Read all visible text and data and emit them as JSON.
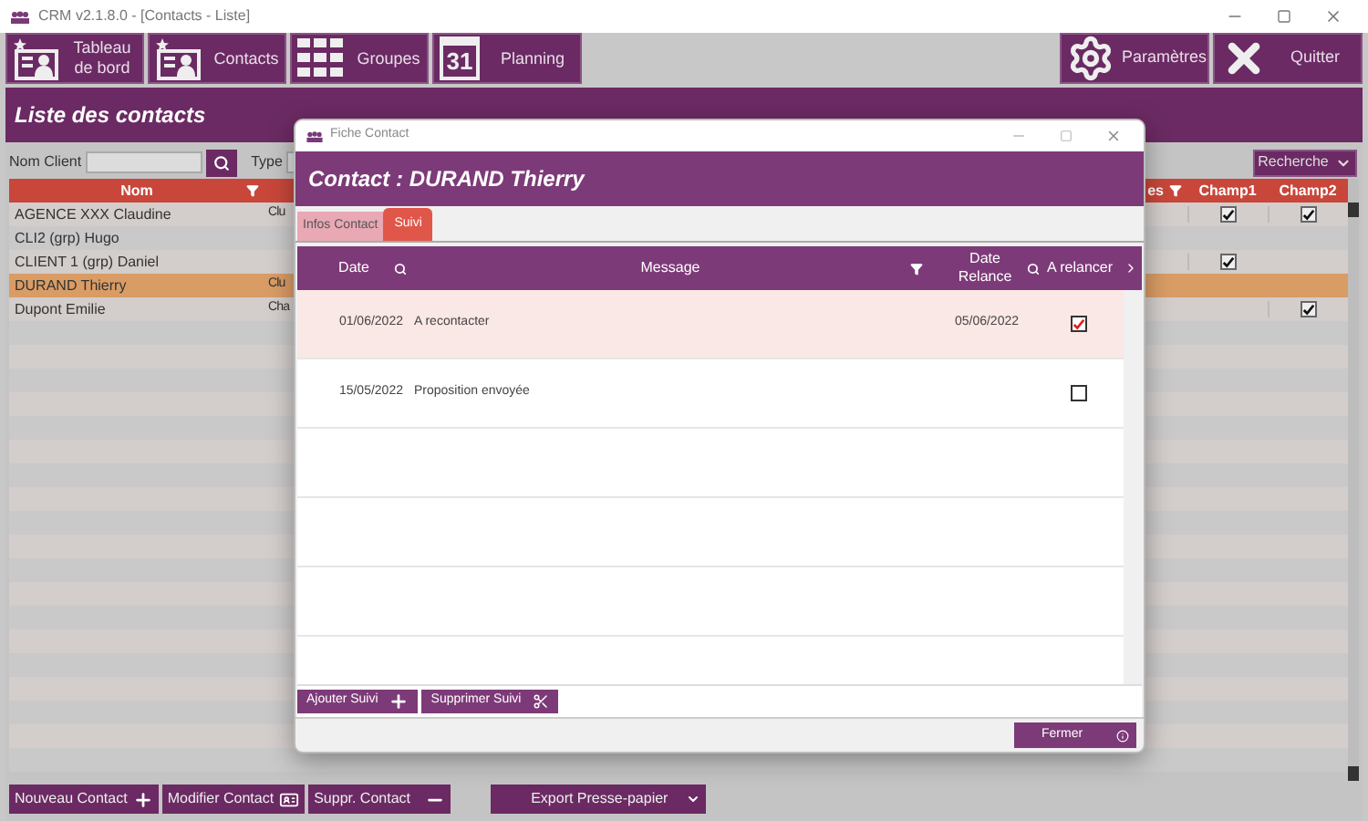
{
  "window": {
    "title": "CRM v2.1.8.0 - [Contacts - Liste]"
  },
  "toolbar": {
    "left": [
      {
        "kind": "contact",
        "label": "Tableau de bord"
      },
      {
        "kind": "contact",
        "label": "Contacts"
      },
      {
        "kind": "grid",
        "label": "Groupes"
      },
      {
        "kind": "calendar",
        "label": "Planning",
        "icon_text": "31"
      }
    ],
    "right": [
      {
        "kind": "gear",
        "label": "Paramètres"
      },
      {
        "kind": "close",
        "label": "Quitter"
      }
    ]
  },
  "page_title": "Liste des contacts",
  "filters": {
    "nom_client_label": "Nom Client",
    "type_label": "Type",
    "search_menu": "Recherche"
  },
  "table": {
    "columns": [
      "Nom",
      "es",
      "Champ1",
      "Champ2"
    ],
    "rows": [
      {
        "nom": "AGENCE XXX Claudine",
        "column_2": "Clu",
        "champ1": true,
        "champ2": true,
        "selected": false
      },
      {
        "nom": "CLI2 (grp) Hugo",
        "column_2": "",
        "champ1": false,
        "champ2": false,
        "selected": false
      },
      {
        "nom": "CLIENT 1 (grp) Daniel",
        "column_2": "",
        "champ1": true,
        "champ2": false,
        "selected": false
      },
      {
        "nom": "DURAND Thierry",
        "column_2": "Clu",
        "champ1": false,
        "champ2": false,
        "selected": true
      },
      {
        "nom": "Dupont Emilie",
        "column_2": "Cha",
        "champ1": false,
        "champ2": true,
        "selected": false
      }
    ]
  },
  "bottom_buttons": [
    {
      "kind": "plus",
      "label": "Nouveau Contact"
    },
    {
      "kind": "card",
      "label": "Modifier Contact"
    },
    {
      "kind": "minus",
      "label": "Suppr. Contact"
    },
    {
      "kind": "dropdown",
      "label": "Export Presse-papier"
    }
  ],
  "dialog": {
    "title": "Fiche Contact",
    "heading": "Contact : DURAND Thierry",
    "tabs": [
      {
        "label": "Infos Contact",
        "selected": false
      },
      {
        "label": "Suivi",
        "selected": true
      }
    ],
    "grid": {
      "columns": [
        "Date",
        "Message",
        "Date Relance",
        "A relancer"
      ],
      "rows": [
        {
          "date": "01/06/2022",
          "message": "A recontacter",
          "date_relance": "05/06/2022",
          "a_relancer": true,
          "selected": true
        },
        {
          "date": "15/05/2022",
          "message": "Proposition envoyée",
          "date_relance": "",
          "a_relancer": false,
          "selected": false
        }
      ]
    },
    "buttons": [
      {
        "kind": "plus",
        "label": "Ajouter Suivi"
      },
      {
        "kind": "scissors",
        "label": "Supprimer Suivi"
      }
    ],
    "close_button": "Fermer"
  }
}
